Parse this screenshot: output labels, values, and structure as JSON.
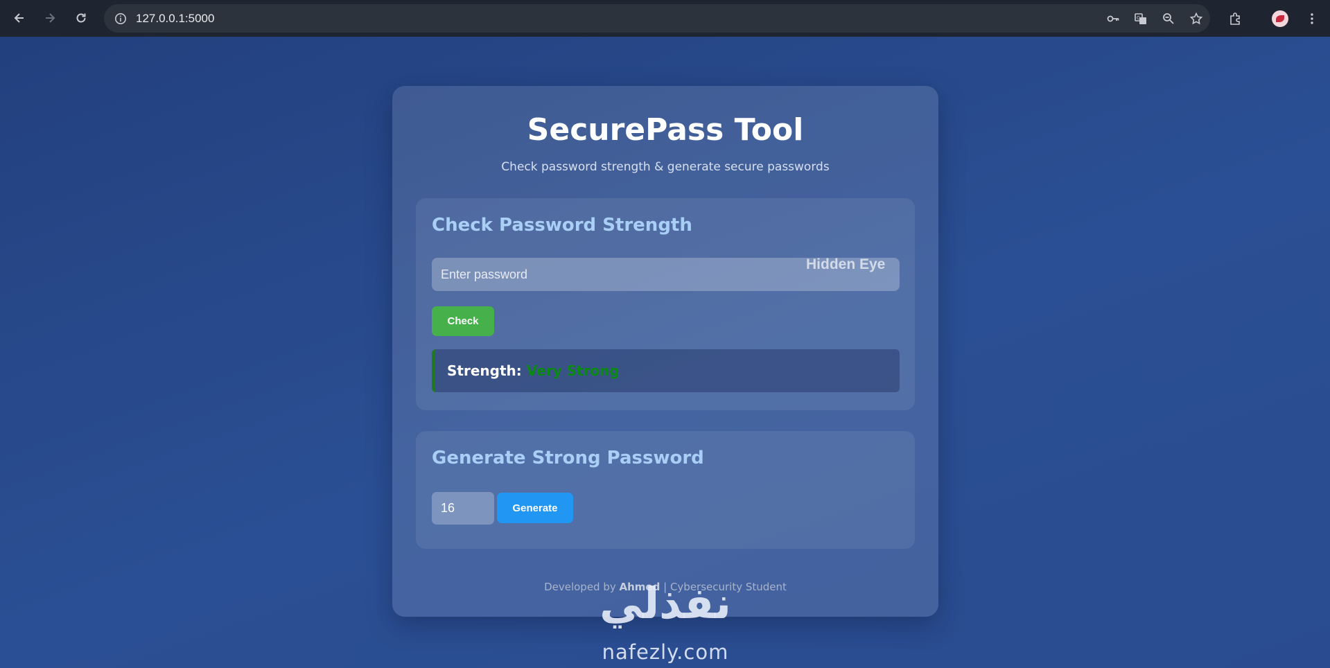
{
  "browser": {
    "url": "127.0.0.1:5000",
    "icons": [
      "back-icon",
      "forward-icon",
      "reload-icon",
      "site-info-icon",
      "key-icon",
      "translate-icon",
      "zoom-icon",
      "star-icon",
      "extensions-icon",
      "avatar",
      "menu-icon"
    ]
  },
  "app": {
    "title": "SecurePass Tool",
    "subtitle": "Check password strength & generate secure passwords",
    "check_section": {
      "heading": "Check Password Strength",
      "input_placeholder": "Enter password",
      "toggle_label": "Hidden Eye",
      "button_label": "Check",
      "result_label": "Strength:",
      "result_value": "Very Strong"
    },
    "generate_section": {
      "heading": "Generate Strong Password",
      "length_value": "16",
      "button_label": "Generate"
    },
    "footer": {
      "prefix": "Developed by",
      "author": "Ahmed",
      "suffix": "| Cybersecurity Student"
    }
  },
  "watermark": {
    "arabic": "نفذلي",
    "latin": "nafezly.com"
  },
  "colors": {
    "check_button": "#46b04a",
    "generate_button": "#2196f3",
    "strength_value": "#0a8a12",
    "heading_accent": "#a9cff7"
  }
}
